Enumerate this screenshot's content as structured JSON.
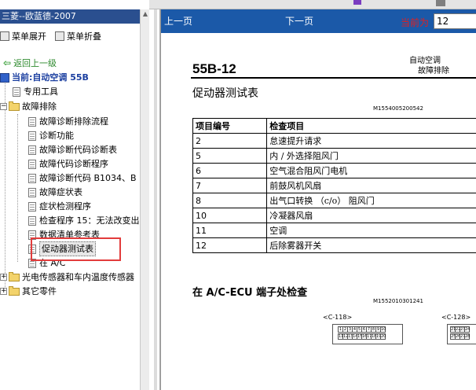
{
  "left": {
    "title": "三菱--欧蓝德-2007",
    "buttons": {
      "expand": "菜单展开",
      "collapse": "菜单折叠"
    },
    "back": "返回上一级",
    "current": "当前:自动空调 55B",
    "tree": [
      {
        "label": "专用工具",
        "type": "doc"
      },
      {
        "label": "故障排除",
        "type": "folder-open"
      },
      {
        "label": "故障诊断排除流程",
        "type": "doc"
      },
      {
        "label": "诊断功能",
        "type": "doc"
      },
      {
        "label": "故障诊断代码诊断表",
        "type": "doc"
      },
      {
        "label": "故障代码诊断程序",
        "type": "doc"
      },
      {
        "label": "故障诊断代码 B1034、B",
        "type": "doc"
      },
      {
        "label": "故障症状表",
        "type": "doc"
      },
      {
        "label": "症状检测程序",
        "type": "doc"
      },
      {
        "label": "检查程序 15：无法改变出",
        "type": "doc"
      },
      {
        "label": "数据清单参考表",
        "type": "doc"
      },
      {
        "label": "促动器测试表",
        "type": "doc",
        "selected": true
      },
      {
        "label": "在 A/C",
        "type": "doc"
      },
      {
        "label": "光电传感器和车内温度传感器",
        "type": "folder"
      },
      {
        "label": "其它零件",
        "type": "folder"
      }
    ]
  },
  "nav": {
    "prev": "上一页",
    "next": "下一页",
    "page_label": "当前为",
    "page_value": "12"
  },
  "doc": {
    "code": "55B-12",
    "category_line1": "自动空调",
    "category_line2": "故障排除",
    "section1": "促动器测试表",
    "figure_id1": "M1554005200542",
    "table": {
      "headers": [
        "项目编号",
        "检查项目"
      ],
      "rows": [
        [
          "2",
          "怠速提升请求"
        ],
        [
          "5",
          "内 / 外选择阻风门"
        ],
        [
          "6",
          "空气混合阻风门电机"
        ],
        [
          "7",
          "前鼓风机风扇"
        ],
        [
          "8",
          "出气口转换 （c/o） 阻风门"
        ],
        [
          "10",
          "冷凝器风扇"
        ],
        [
          "11",
          "空调"
        ],
        [
          "12",
          "后除雾器开关"
        ]
      ]
    },
    "section2": "在 A/C-ECU 端子处检查",
    "figure_id2": "M1552010301241",
    "connectors": [
      {
        "label": "<C-118>",
        "pins_top": [
          "1",
          "2",
          "3",
          "4",
          "5",
          "6",
          "7",
          "8",
          "9",
          "10"
        ],
        "pins_bottom": [
          "11",
          "12",
          "13",
          "14",
          "15",
          "16",
          "17",
          "18",
          "19",
          "20"
        ]
      },
      {
        "label": "<C-128>",
        "pins_top": [
          "21",
          "22",
          "23",
          "24"
        ],
        "pins_bottom": [
          "25",
          "26",
          "27",
          "28"
        ]
      }
    ]
  }
}
